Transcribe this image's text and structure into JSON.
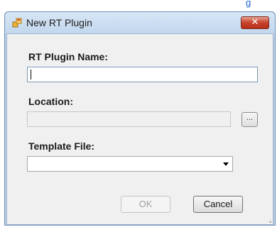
{
  "background": {
    "link_fragment": "g"
  },
  "dialog": {
    "title": "New RT Plugin",
    "close_glyph": "✕",
    "fields": {
      "plugin_name": {
        "label": "RT Plugin Name:",
        "value": ""
      },
      "location": {
        "label": "Location:",
        "value": "",
        "browse_label": "..."
      },
      "template_file": {
        "label": "Template File:",
        "selected": ""
      }
    },
    "buttons": {
      "ok": "OK",
      "cancel": "Cancel"
    }
  },
  "icons": {
    "app": "window-app-icon",
    "close": "close-icon",
    "dropdown": "chevron-down-icon",
    "grip": "resize-grip-icon"
  },
  "colors": {
    "title_bar": "#c2d7ee",
    "frame": "#b9d1ea",
    "client": "#f0f0f0",
    "close": "#c7412b",
    "link": "#1a5fd6"
  }
}
